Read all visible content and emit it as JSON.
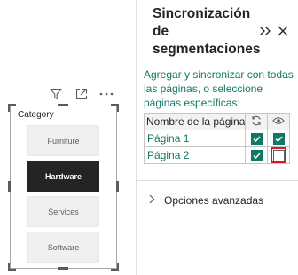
{
  "slicer": {
    "title": "Category",
    "items": [
      {
        "label": "Furniture",
        "selected": false
      },
      {
        "label": "Hardware",
        "selected": true
      },
      {
        "label": "Services",
        "selected": false
      },
      {
        "label": "Software",
        "selected": false
      }
    ],
    "header_icons": [
      "filter-icon",
      "focus-mode-icon",
      "more-options-icon"
    ]
  },
  "pane": {
    "title": "Sincronización de segmentaciones",
    "description": "Agregar y sincronizar con todas las páginas, o seleccione páginas específicas:",
    "table": {
      "header_name": "Nombre de la página",
      "header_icons": [
        "sync-icon",
        "visibility-icon"
      ],
      "rows": [
        {
          "name": "Página 1",
          "sync": true,
          "visible": true
        },
        {
          "name": "Página 2",
          "sync": true,
          "visible": false
        }
      ]
    },
    "advanced_label": "Opciones avanzadas"
  },
  "colors": {
    "accent": "#117865",
    "highlight": "#e81123",
    "selected_tile": "#252423"
  }
}
